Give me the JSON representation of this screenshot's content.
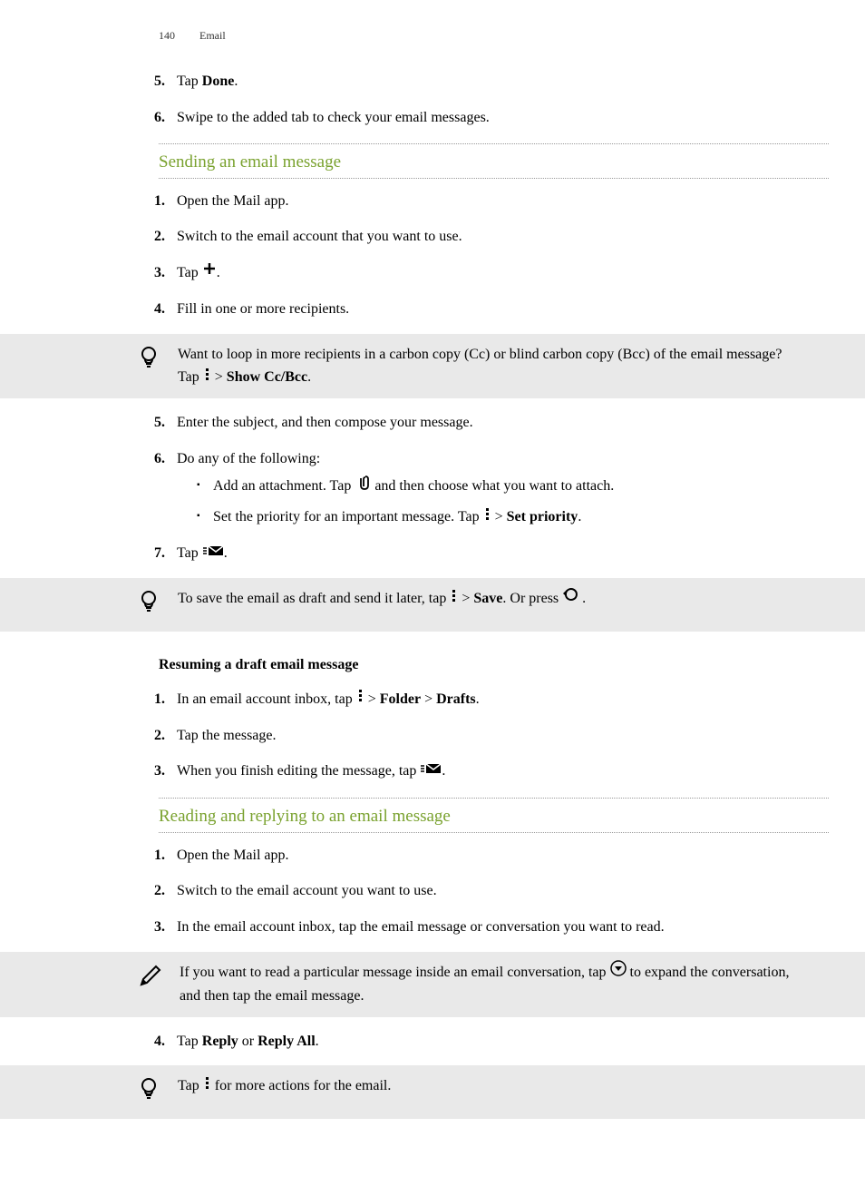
{
  "header": {
    "page_number": "140",
    "section": "Email"
  },
  "intro_steps": [
    {
      "n": "5.",
      "pre": "Tap ",
      "bold": "Done",
      "post": "."
    },
    {
      "n": "6.",
      "pre": "Swipe to the added tab to check your email messages.",
      "bold": "",
      "post": ""
    }
  ],
  "sec1": {
    "title": "Sending an email message",
    "steps_a": [
      {
        "n": "1.",
        "t": "Open the Mail app."
      },
      {
        "n": "2.",
        "t": "Switch to the email account that you want to use."
      },
      {
        "n": "3.",
        "pre": "Tap ",
        "icon": "plus",
        "post": "."
      },
      {
        "n": "4.",
        "t": "Fill in one or more recipients."
      }
    ],
    "callout1": {
      "pre": "Want to loop in more recipients in a carbon copy (Cc) or blind carbon copy (Bcc) of the email message? Tap ",
      "icon": "more",
      "mid": " > ",
      "bold": "Show Cc/Bcc",
      "post": "."
    },
    "steps_b": [
      {
        "n": "5.",
        "t": "Enter the subject, and then compose your message."
      },
      {
        "n": "6.",
        "t": "Do any of the following:",
        "bullets": [
          {
            "pre": "Add an attachment. Tap ",
            "icon": "attach",
            "post": "  and then choose what you want to attach."
          },
          {
            "pre": "Set the priority for an important message. Tap ",
            "icon": "more",
            "mid": " > ",
            "bold": "Set priority",
            "post": "."
          }
        ]
      },
      {
        "n": "7.",
        "pre": "Tap ",
        "icon": "send",
        "post": "."
      }
    ],
    "callout2": {
      "pre": "To save the email as draft and send it later, tap ",
      "icon": "more",
      "mid": " > ",
      "bold": "Save",
      "post1": ". Or press  ",
      "icon2": "back",
      "post2": " ."
    },
    "subheading": "Resuming a draft email message",
    "steps_c": [
      {
        "n": "1.",
        "pre": "In an email account inbox, tap ",
        "icon": "more",
        "mid": " > ",
        "bold1": "Folder",
        "mid2": " > ",
        "bold2": "Drafts",
        "post": "."
      },
      {
        "n": "2.",
        "t": "Tap the message."
      },
      {
        "n": "3.",
        "pre": "When you finish editing the message, tap ",
        "icon": "send",
        "post": "."
      }
    ]
  },
  "sec2": {
    "title": "Reading and replying to an email message",
    "steps_a": [
      {
        "n": "1.",
        "t": "Open the Mail app."
      },
      {
        "n": "2.",
        "t": "Switch to the email account you want to use."
      },
      {
        "n": "3.",
        "t": "In the email account inbox, tap the email message or conversation you want to read."
      }
    ],
    "callout1": {
      "pre": "If you want to read a particular message inside an email conversation, tap ",
      "icon": "expand",
      "post": " to expand the conversation, and then tap the email message."
    },
    "steps_b": [
      {
        "n": "4.",
        "pre": "Tap ",
        "bold1": "Reply",
        "mid": " or ",
        "bold2": "Reply All",
        "post": "."
      }
    ],
    "callout2": {
      "pre": "Tap ",
      "icon": "more",
      "post": " for more actions for the email."
    }
  }
}
